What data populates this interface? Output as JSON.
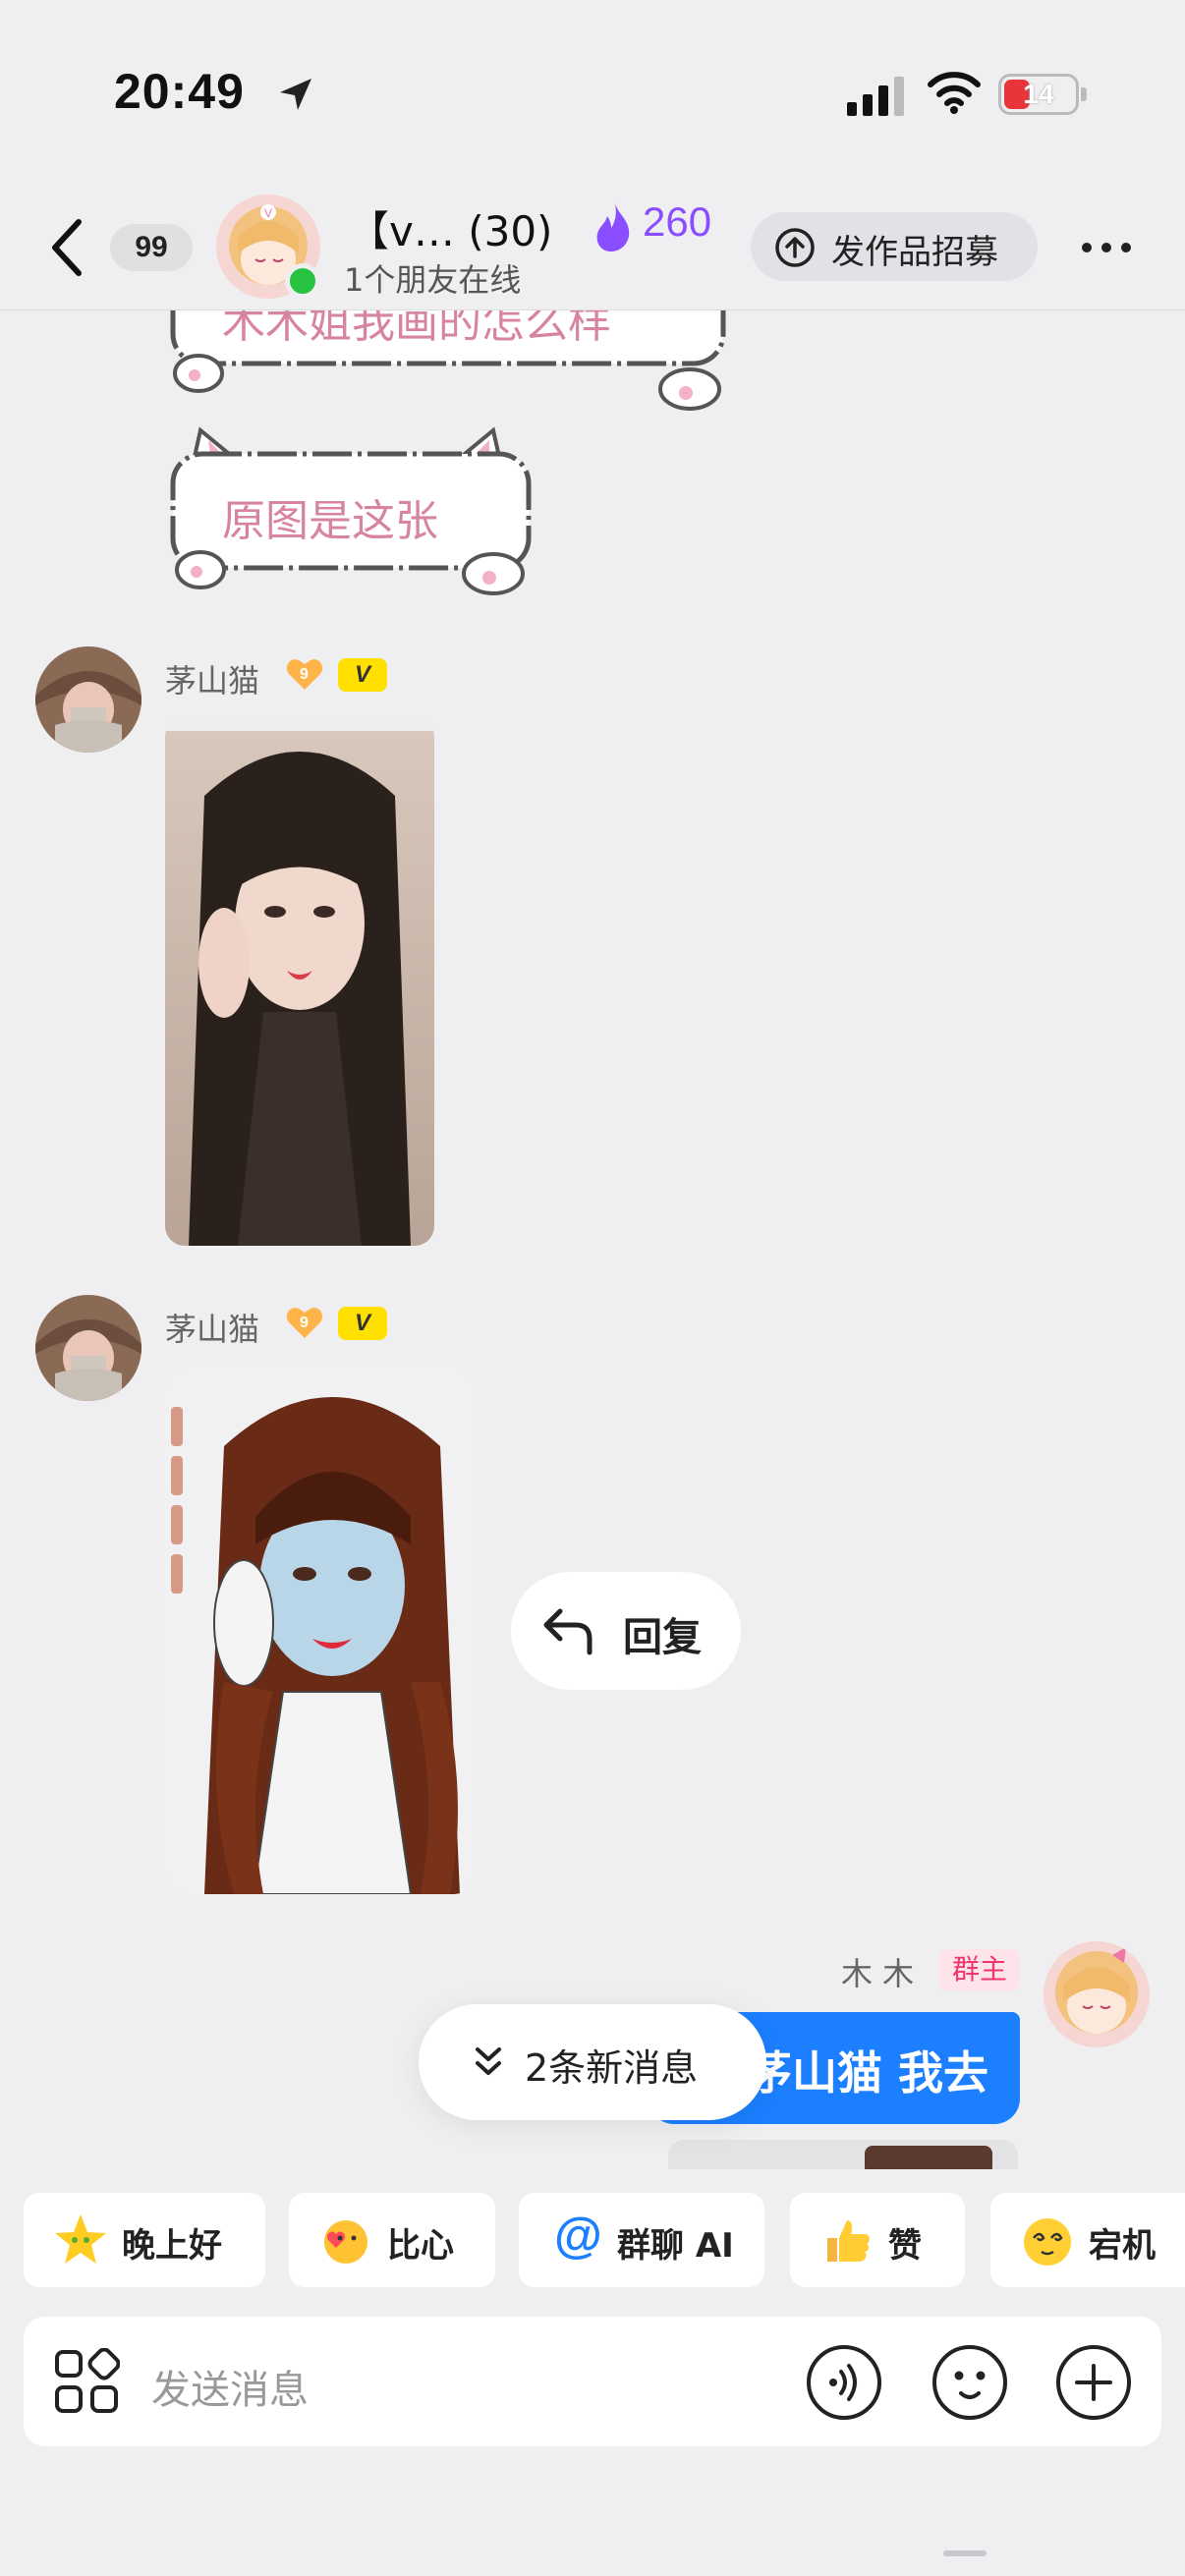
{
  "status": {
    "time": "20:49",
    "battery": "14",
    "battery_pct": 14
  },
  "header": {
    "unread": "99",
    "title": "【v…  (30)",
    "flame_count": "260",
    "online": "1个朋友在线",
    "post_button": "发作品招募"
  },
  "stickers": [
    {
      "text": "木木姐我画的怎么样"
    },
    {
      "text": "原图是这张"
    }
  ],
  "messages": [
    {
      "sender": "茅山猫",
      "level": "9",
      "vip": "V"
    },
    {
      "sender": "茅山猫",
      "level": "9",
      "vip": "V"
    }
  ],
  "reply_action": "回复",
  "owner_message": {
    "sender": "木 木",
    "tag": "群主",
    "text": "茅山猫 我去"
  },
  "new_messages": "2条新消息",
  "quick_replies": [
    {
      "label": "晚上好",
      "icon": "star-face-icon"
    },
    {
      "label": "比心",
      "icon": "heart-hands-icon"
    },
    {
      "label": "群聊 AI",
      "icon": "at-icon"
    },
    {
      "label": "赞",
      "icon": "thumbs-up-icon"
    },
    {
      "label": "宕机",
      "icon": "dizzy-face-icon"
    }
  ],
  "input": {
    "placeholder": "发送消息"
  },
  "colors": {
    "accent": "#1b7fff",
    "flame": "#8a4dff",
    "owner_tag": "#f0366a",
    "online": "#27c340"
  }
}
